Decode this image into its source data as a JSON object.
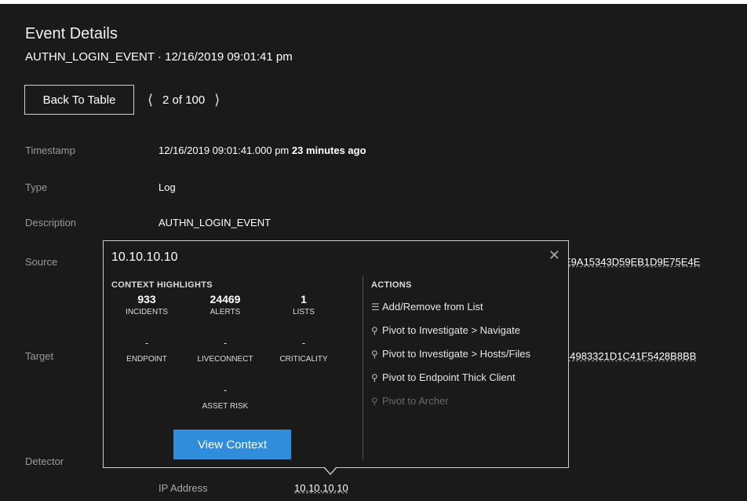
{
  "header": {
    "title": "Event Details",
    "subtitle": "AUTHN_LOGIN_EVENT · 12/16/2019 09:01:41 pm"
  },
  "nav": {
    "back_label": "Back To Table",
    "prev_icon": "chevron-left-icon",
    "next_icon": "chevron-right-icon",
    "position": "2 of 100"
  },
  "fields": {
    "timestamp": {
      "label": "Timestamp",
      "value": "12/16/2019 09:01:41.000 pm",
      "relative": "23 minutes ago"
    },
    "type": {
      "label": "Type",
      "value": "Log"
    },
    "description": {
      "label": "Description",
      "value": "AUTHN_LOGIN_EVENT"
    },
    "source": {
      "label": "Source",
      "hash_fragment": "E9A15343D59EB1D9E75E4E"
    },
    "target": {
      "label": "Target",
      "hash_fragment": "44983321D1C41F5428B8BB"
    },
    "detector": {
      "label": "Detector"
    },
    "ip": {
      "label": "IP Address",
      "value": "10.10.10.10"
    }
  },
  "popup": {
    "title": "10.10.10.10",
    "close_icon": "close-icon",
    "highlights_heading": "CONTEXT HIGHLIGHTS",
    "stats": [
      {
        "num": "933",
        "label": "INCIDENTS"
      },
      {
        "num": "24469",
        "label": "ALERTS"
      },
      {
        "num": "1",
        "label": "LISTS"
      }
    ],
    "stats2": [
      {
        "value": "-",
        "label": "ENDPOINT"
      },
      {
        "value": "-",
        "label": "LIVECONNECT"
      },
      {
        "value": "-",
        "label": "CRITICALITY"
      }
    ],
    "asset_risk": {
      "value": "-",
      "label": "ASSET RISK"
    },
    "view_context_label": "View Context",
    "actions_heading": "ACTIONS",
    "actions": [
      {
        "icon": "list-icon",
        "label": "Add/Remove from List",
        "enabled": true
      },
      {
        "icon": "search-icon",
        "label": "Pivot to Investigate > Navigate",
        "enabled": true
      },
      {
        "icon": "search-icon",
        "label": "Pivot to Investigate > Hosts/Files",
        "enabled": true
      },
      {
        "icon": "search-icon",
        "label": "Pivot to Endpoint Thick Client",
        "enabled": true
      },
      {
        "icon": "search-icon",
        "label": "Pivot to Archer",
        "enabled": false
      }
    ]
  },
  "colors": {
    "background": "#1a1a1a",
    "accent": "#2f8ddc",
    "muted_text": "#9a9a9a"
  }
}
